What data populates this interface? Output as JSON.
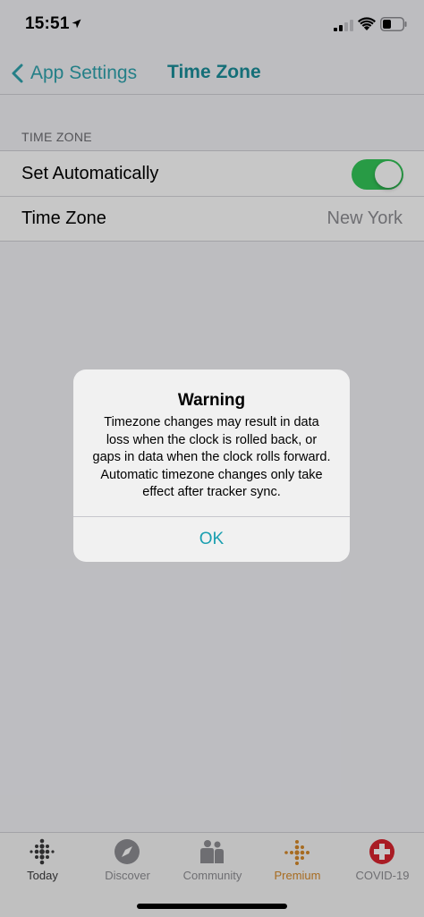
{
  "status_bar": {
    "time": "15:51"
  },
  "nav": {
    "back_label": "App Settings",
    "title": "Time Zone"
  },
  "settings": {
    "section_header": "TIME ZONE",
    "rows": [
      {
        "label": "Set Automatically",
        "toggle_on": true
      },
      {
        "label": "Time Zone",
        "value": "New York"
      }
    ]
  },
  "alert": {
    "title": "Warning",
    "message": "Timezone changes may result in data loss when the clock is rolled back, or gaps in data when the clock rolls forward. Automatic timezone changes only take effect after tracker sync.",
    "button_label": "OK"
  },
  "tabs": [
    {
      "label": "Today",
      "icon": "fitbit-dots-icon",
      "active": true
    },
    {
      "label": "Discover",
      "icon": "compass-icon"
    },
    {
      "label": "Community",
      "icon": "community-icon"
    },
    {
      "label": "Premium",
      "icon": "premium-icon",
      "color": "#d68a2a"
    },
    {
      "label": "COVID-19",
      "icon": "medical-cross-icon",
      "color": "#d9242f"
    }
  ],
  "colors": {
    "accent": "#1c8f9a",
    "toggle_on": "#34c759",
    "alert_button": "#1a9fb0"
  }
}
